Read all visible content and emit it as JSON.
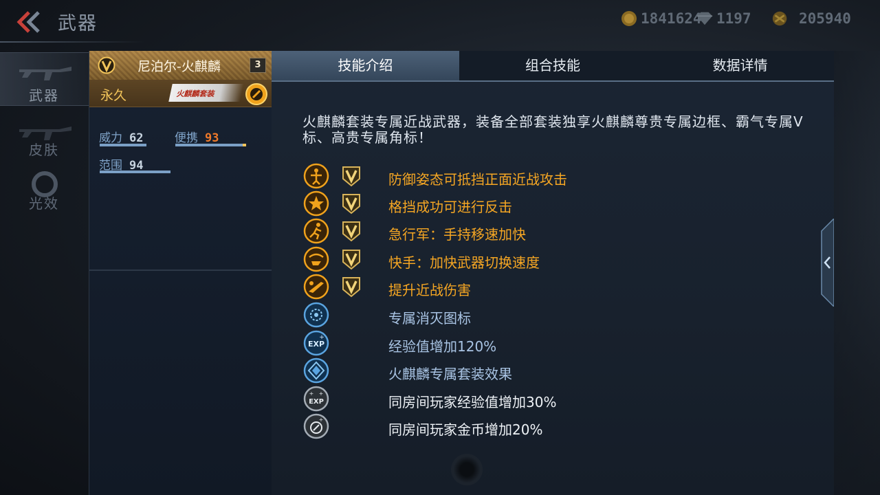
{
  "header": {
    "title": "武器",
    "currencies": [
      {
        "icon": "gold-coin-icon",
        "value": "1841624"
      },
      {
        "icon": "diamond-icon",
        "value": "1197"
      },
      {
        "icon": "honor-coin-icon",
        "value": "205940"
      }
    ]
  },
  "sidebar": {
    "items": [
      {
        "label": "武器",
        "active": true
      },
      {
        "label": "皮肤",
        "active": false
      },
      {
        "label": "光效",
        "active": false
      }
    ]
  },
  "weapon_card": {
    "name": "尼泊尔-火麒麟",
    "level": "3",
    "duration": "永久",
    "suit_badge": "火麒麟套装",
    "stats": [
      {
        "label": "威力",
        "value": "62"
      },
      {
        "label": "便携",
        "value": "93"
      },
      {
        "label": "范围",
        "value": "94"
      }
    ],
    "stat_fill": {
      "power": 0.62,
      "portability": 0.93,
      "range": 0.94
    }
  },
  "tabs": [
    {
      "label": "技能介绍",
      "active": true
    },
    {
      "label": "组合技能",
      "active": false
    },
    {
      "label": "数据详情",
      "active": false
    }
  ],
  "description": "火麒麟套装专属近战武器，装备全部套装独享火麒麟尊贵专属边框、霸气专属V标、高贵专属角标！",
  "skills": [
    {
      "icon": "guard-stance-icon",
      "vip": true,
      "text": "防御姿态可抵挡正面近战攻击",
      "color": "gold"
    },
    {
      "icon": "star-icon",
      "vip": true,
      "text": "格挡成功可进行反击",
      "color": "gold"
    },
    {
      "icon": "running-man-icon",
      "vip": true,
      "text": "急行军：手持移速加快",
      "color": "gold"
    },
    {
      "icon": "quick-hand-icon",
      "vip": true,
      "text": "快手：加快武器切换速度",
      "color": "gold"
    },
    {
      "icon": "melee-damage-icon",
      "vip": true,
      "text": "提升近战伤害",
      "color": "gold"
    },
    {
      "icon": "kill-icon-badge",
      "vip": false,
      "text": "专属消灭图标",
      "color": "blue"
    },
    {
      "icon": "exp-boost-icon",
      "vip": false,
      "text": "经验值增加120%",
      "color": "blue"
    },
    {
      "icon": "suit-effect-icon",
      "vip": false,
      "text": "火麒麟专属套装效果",
      "color": "blue"
    },
    {
      "icon": "room-exp-icon",
      "vip": false,
      "text": "同房间玩家经验值增加30%",
      "color": "white"
    },
    {
      "icon": "room-gold-icon",
      "vip": false,
      "text": "同房间玩家金币增加20%",
      "color": "white"
    }
  ]
}
